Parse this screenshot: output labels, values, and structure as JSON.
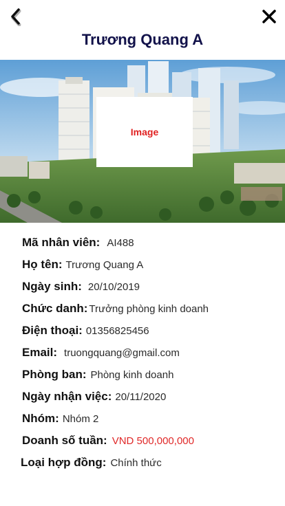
{
  "header": {
    "title": "Trương Quang A"
  },
  "hero": {
    "placeholder_label": "Image"
  },
  "fields": [
    {
      "label": "Mã nhân viên:",
      "value": "AI488"
    },
    {
      "label": "Họ tên:",
      "value": "Trương Quang A"
    },
    {
      "label": "Ngày sinh:",
      "value": "20/10/2019"
    },
    {
      "label": "Chức danh:",
      "value": "Trưởng phòng kinh doanh"
    },
    {
      "label": "Điện thoại:",
      "value": "01356825456"
    },
    {
      "label": "Email:",
      "value": "truongquang@gmail.com"
    },
    {
      "label": "Phòng ban:",
      "value": "Phòng kinh doanh"
    },
    {
      "label": "Ngày nhận việc:",
      "value": "20/11/2020"
    },
    {
      "label": "Nhóm:",
      "value": "Nhóm 2"
    },
    {
      "label": "Doanh số tuần:",
      "value": "VND 500,000,000",
      "value_color": "#e02828"
    },
    {
      "label": "Loại hợp đồng:",
      "value": "Chính thức"
    }
  ],
  "icons": {
    "back": "chevron-left-icon",
    "close": "close-icon"
  },
  "colors": {
    "title": "#12124a",
    "accent_red": "#e02828"
  }
}
